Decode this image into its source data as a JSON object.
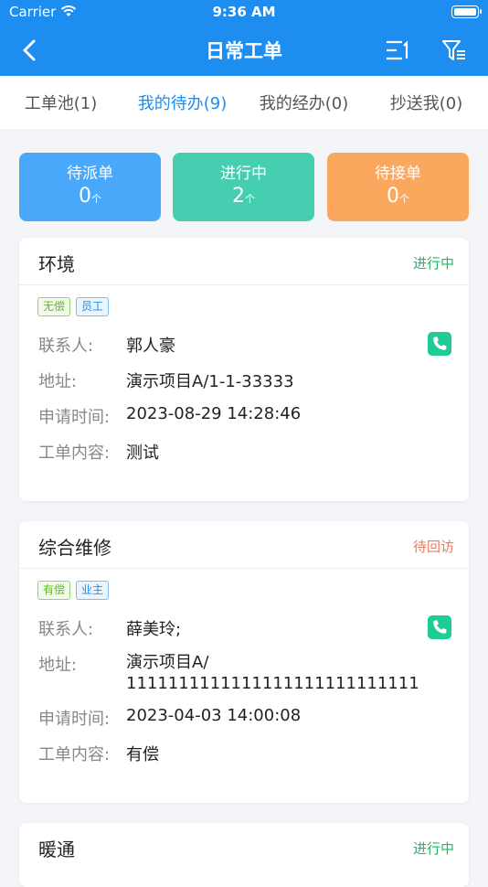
{
  "status_bar": {
    "carrier": "Carrier",
    "time": "9:36 AM"
  },
  "nav": {
    "title": "日常工单"
  },
  "tabs": [
    {
      "label": "工单池(1)",
      "active": false
    },
    {
      "label": "我的待办(9)",
      "active": true
    },
    {
      "label": "我的经办(0)",
      "active": false
    },
    {
      "label": "抄送我(0)",
      "active": false
    }
  ],
  "stats": [
    {
      "label": "待派单",
      "value": "0",
      "unit": "个",
      "color": "#4aa8fb"
    },
    {
      "label": "进行中",
      "value": "2",
      "unit": "个",
      "color": "#45cfb0"
    },
    {
      "label": "待接单",
      "value": "0",
      "unit": "个",
      "color": "#fba85e"
    }
  ],
  "cards": [
    {
      "title": "环境",
      "status": "进行中",
      "status_color": "#20b86a",
      "tags": [
        "无偿",
        "员工"
      ],
      "contact_label": "联系人:",
      "contact": "郭人豪",
      "address_label": "地址:",
      "address": "演示项目A/1-1-33333",
      "time_label": "申请时间:",
      "time": "2023-08-29 14:28:46",
      "content_label": "工单内容:",
      "content": "测试"
    },
    {
      "title": "综合维修",
      "status": "待回访",
      "status_color": "#f07a5a",
      "tags": [
        "有偿",
        "业主"
      ],
      "contact_label": "联系人:",
      "contact": "薛美玲;",
      "address_label": "地址:",
      "address": "演示项目A/",
      "address_line2": "1111111111111111111111111111",
      "time_label": "申请时间:",
      "time": "2023-04-03 14:00:08",
      "content_label": "工单内容:",
      "content": "有偿"
    },
    {
      "title": "暖通",
      "status": "进行中",
      "status_color": "#20b86a"
    }
  ],
  "colors": {
    "primary": "#1d8df0",
    "background": "#f4f5f9"
  }
}
